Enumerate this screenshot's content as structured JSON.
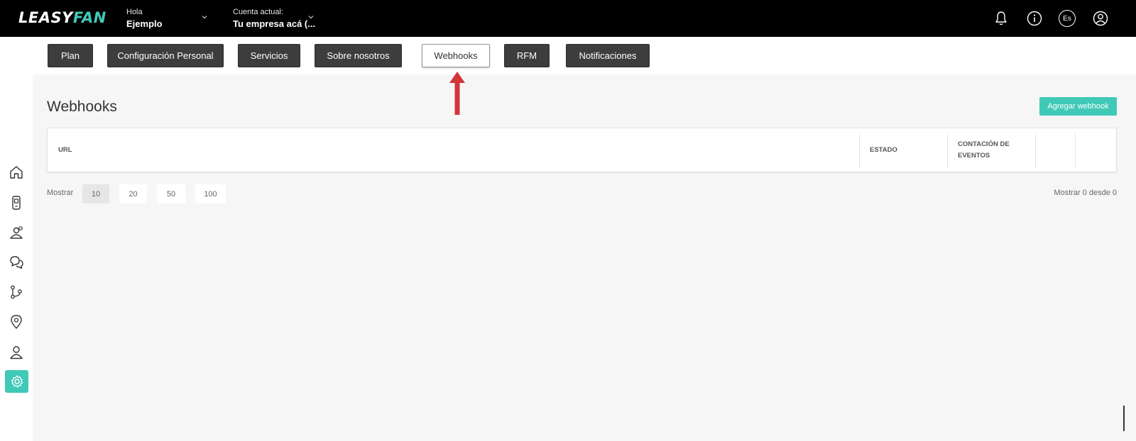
{
  "header": {
    "logo_part1": "LEASY",
    "logo_part2": "FAN",
    "greeting_label": "Hola",
    "user_name": "Ejemplo",
    "account_label": "Cuenta actual:",
    "account_name": "Tu empresa acá (...",
    "language": "Es"
  },
  "tabs": [
    {
      "label": "Plan"
    },
    {
      "label": "Configuración Personal"
    },
    {
      "label": "Servicios"
    },
    {
      "label": "Sobre nosotros"
    },
    {
      "label": "Webhooks",
      "active": true
    },
    {
      "label": "RFM"
    },
    {
      "label": "Notificaciones"
    }
  ],
  "page": {
    "title": "Webhooks",
    "add_button": "Agregar webhook"
  },
  "table": {
    "columns": [
      "URL",
      "ESTADO",
      "CONTACIÓN DE\nEVENTOS",
      "",
      ""
    ],
    "rows": []
  },
  "pagination": {
    "show_label": "Mostrar",
    "sizes": [
      "10",
      "20",
      "50",
      "100"
    ],
    "selected": "10",
    "count_text": "Mostrar 0 desde 0"
  },
  "sidebar": {
    "items": [
      "home-icon",
      "mobile-device-icon",
      "users-icon",
      "chat-icon",
      "flow-icon",
      "location-icon",
      "user-icon",
      "settings-icon"
    ],
    "active": "settings-icon"
  },
  "colors": {
    "accent": "#40c9b7",
    "topbar": "#000000",
    "tab_bg": "#3d3d3d",
    "annotation_arrow": "#d0363b"
  }
}
